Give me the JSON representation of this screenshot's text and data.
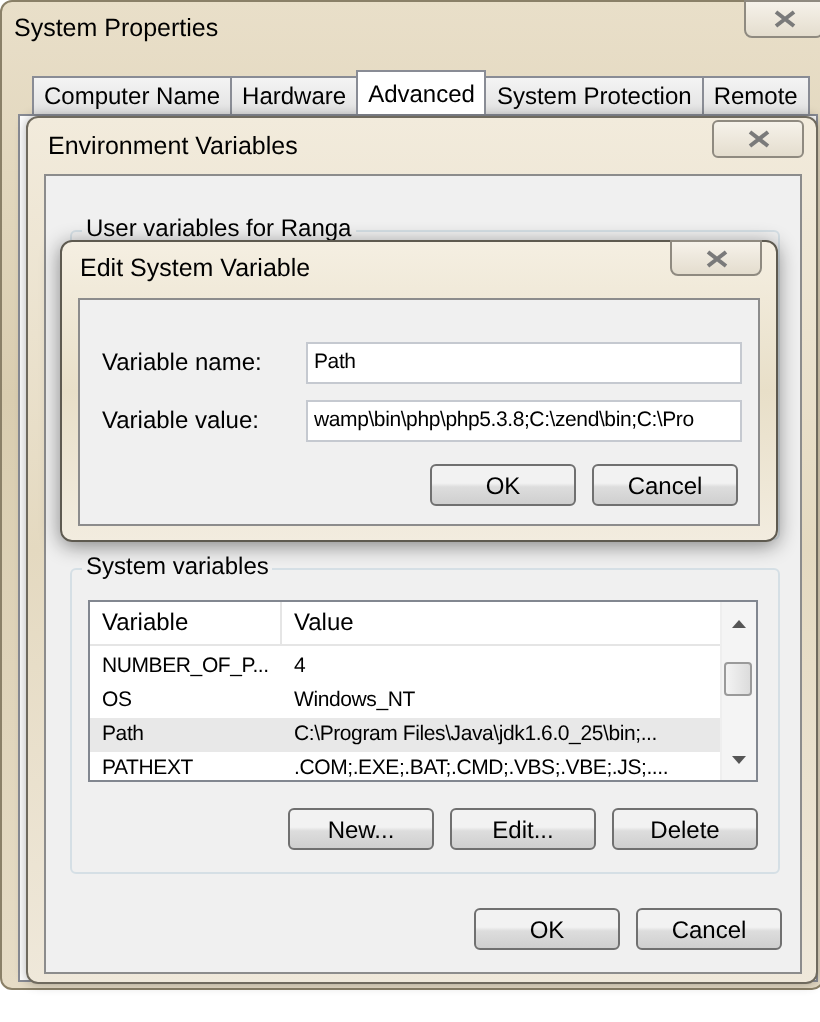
{
  "system_properties": {
    "title": "System Properties",
    "tabs": [
      {
        "label": "Computer Name",
        "selected": false
      },
      {
        "label": "Hardware",
        "selected": false
      },
      {
        "label": "Advanced",
        "selected": true
      },
      {
        "label": "System Protection",
        "selected": false
      },
      {
        "label": "Remote",
        "selected": false
      }
    ]
  },
  "environment_variables": {
    "title": "Environment Variables",
    "user_variables": {
      "label": "User variables for Ranga"
    },
    "system_variables": {
      "label": "System variables",
      "columns": [
        "Variable",
        "Value"
      ],
      "rows": [
        {
          "variable": "NUMBER_OF_P...",
          "value": "4",
          "selected": false
        },
        {
          "variable": "OS",
          "value": "Windows_NT",
          "selected": false
        },
        {
          "variable": "Path",
          "value": "C:\\Program Files\\Java\\jdk1.6.0_25\\bin;...",
          "selected": true
        },
        {
          "variable": "PATHEXT",
          "value": ".COM;.EXE;.BAT;.CMD;.VBS;.VBE;.JS;....",
          "selected": false
        }
      ],
      "buttons": [
        "New...",
        "Edit...",
        "Delete"
      ]
    },
    "buttons": [
      "OK",
      "Cancel"
    ]
  },
  "edit_dialog": {
    "title": "Edit System Variable",
    "fields": [
      {
        "label": "Variable name:",
        "value": "Path"
      },
      {
        "label": "Variable value:",
        "value": "wamp\\bin\\php\\php5.3.8;C:\\zend\\bin;C:\\Pro"
      }
    ],
    "buttons": [
      "OK",
      "Cancel"
    ]
  }
}
